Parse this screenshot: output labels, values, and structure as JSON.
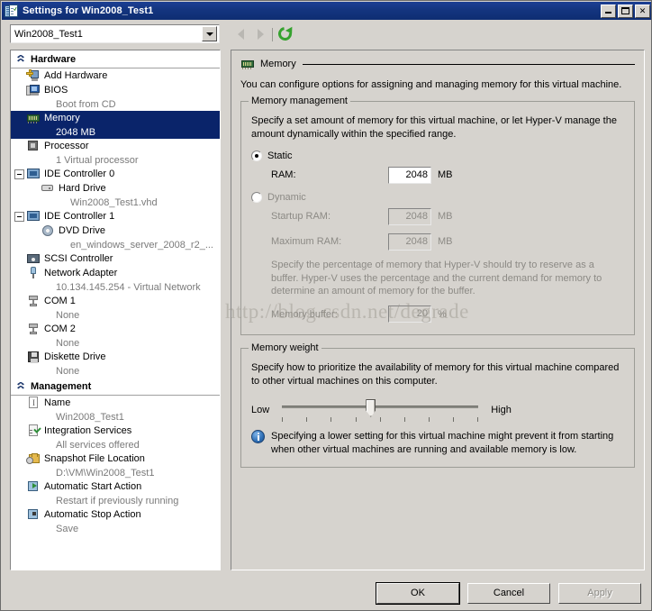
{
  "window": {
    "title": "Settings for Win2008_Test1",
    "icon": "settings-icon",
    "minimize_label": "Minimize",
    "maximize_label": "Maximize",
    "close_label": "Close"
  },
  "toolbar": {
    "vm_selector_value": "Win2008_Test1",
    "back_label": "Back",
    "forward_label": "Forward",
    "refresh_label": "Refresh"
  },
  "sidebar": {
    "sections": [
      {
        "title": "Hardware",
        "items": [
          {
            "label": "Add Hardware",
            "sub": "",
            "icon": "add-hardware-icon",
            "indent": 0,
            "expander": "none",
            "selected": false
          },
          {
            "label": "BIOS",
            "sub": "Boot from CD",
            "icon": "bios-icon",
            "indent": 0,
            "expander": "none",
            "selected": false
          },
          {
            "label": "Memory",
            "sub": "2048 MB",
            "icon": "memory-icon",
            "indent": 0,
            "expander": "none",
            "selected": true
          },
          {
            "label": "Processor",
            "sub": "1 Virtual processor",
            "icon": "processor-icon",
            "indent": 0,
            "expander": "none",
            "selected": false
          },
          {
            "label": "IDE Controller 0",
            "sub": "",
            "icon": "ide-controller-icon",
            "indent": 0,
            "expander": "minus",
            "selected": false
          },
          {
            "label": "Hard Drive",
            "sub": "Win2008_Test1.vhd",
            "icon": "hard-drive-icon",
            "indent": 1,
            "expander": "none",
            "selected": false
          },
          {
            "label": "IDE Controller 1",
            "sub": "",
            "icon": "ide-controller-icon",
            "indent": 0,
            "expander": "minus",
            "selected": false
          },
          {
            "label": "DVD Drive",
            "sub": "en_windows_server_2008_r2_...",
            "icon": "dvd-drive-icon",
            "indent": 1,
            "expander": "none",
            "selected": false
          },
          {
            "label": "SCSI Controller",
            "sub": "",
            "icon": "scsi-controller-icon",
            "indent": 0,
            "expander": "none",
            "selected": false
          },
          {
            "label": "Network Adapter",
            "sub": "10.134.145.254 - Virtual Network",
            "icon": "network-adapter-icon",
            "indent": 0,
            "expander": "none",
            "selected": false
          },
          {
            "label": "COM 1",
            "sub": "None",
            "icon": "com-port-icon",
            "indent": 0,
            "expander": "none",
            "selected": false
          },
          {
            "label": "COM 2",
            "sub": "None",
            "icon": "com-port-icon",
            "indent": 0,
            "expander": "none",
            "selected": false
          },
          {
            "label": "Diskette Drive",
            "sub": "None",
            "icon": "diskette-drive-icon",
            "indent": 0,
            "expander": "none",
            "selected": false
          }
        ]
      },
      {
        "title": "Management",
        "items": [
          {
            "label": "Name",
            "sub": "Win2008_Test1",
            "icon": "name-icon",
            "indent": 0,
            "expander": "none",
            "selected": false
          },
          {
            "label": "Integration Services",
            "sub": "All services offered",
            "icon": "integration-services-icon",
            "indent": 0,
            "expander": "none",
            "selected": false
          },
          {
            "label": "Snapshot File Location",
            "sub": "D:\\VM\\Win2008_Test1",
            "icon": "snapshot-folder-icon",
            "indent": 0,
            "expander": "none",
            "selected": false
          },
          {
            "label": "Automatic Start Action",
            "sub": "Restart if previously running",
            "icon": "automatic-start-icon",
            "indent": 0,
            "expander": "none",
            "selected": false
          },
          {
            "label": "Automatic Stop Action",
            "sub": "Save",
            "icon": "automatic-stop-icon",
            "indent": 0,
            "expander": "none",
            "selected": false
          }
        ]
      }
    ]
  },
  "main": {
    "header_title": "Memory",
    "header_icon": "memory-icon",
    "intro": "You can configure options for assigning and managing memory for this virtual machine.",
    "memory_management": {
      "title": "Memory management",
      "description": "Specify a set amount of memory for this virtual machine, or let Hyper-V manage the amount dynamically within the specified range.",
      "static_label": "Static",
      "static_selected": true,
      "ram_label": "RAM:",
      "ram_value": "2048",
      "ram_unit": "MB",
      "dynamic_label": "Dynamic",
      "dynamic_selected": false,
      "startup_ram_label": "Startup RAM:",
      "startup_ram_value": "2048",
      "startup_ram_unit": "MB",
      "maximum_ram_label": "Maximum RAM:",
      "maximum_ram_value": "2048",
      "maximum_ram_unit": "MB",
      "buffer_description": "Specify the percentage of memory that Hyper-V should try to reserve as a buffer. Hyper-V uses the percentage and the current demand for memory to determine an amount of memory for the buffer.",
      "memory_buffer_label": "Memory buffer:",
      "memory_buffer_value": "20",
      "memory_buffer_unit": "%"
    },
    "memory_weight": {
      "title": "Memory weight",
      "description": "Specify how to prioritize the availability of memory for this virtual machine compared to other virtual machines on this computer.",
      "low_label": "Low",
      "high_label": "High",
      "slider_position_percent": 45,
      "tick_count": 9,
      "info_text": "Specifying a lower setting for this virtual machine might prevent it from starting when other virtual machines are running and available memory is low."
    }
  },
  "footer": {
    "ok_label": "OK",
    "cancel_label": "Cancel",
    "apply_label": "Apply",
    "apply_disabled": true
  },
  "watermark": "http://blog.csdn.net/degrade"
}
